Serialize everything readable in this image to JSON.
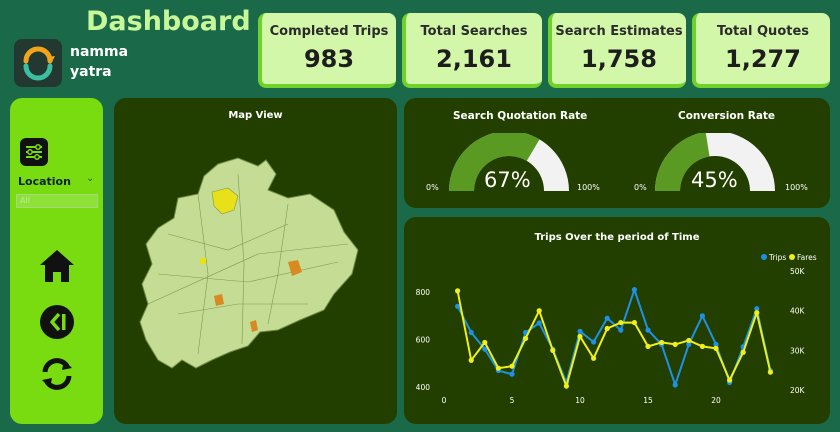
{
  "header": {
    "title": "Dashboard",
    "brand_line1": "namma",
    "brand_line2": "yatra"
  },
  "kpis": [
    {
      "label": "Completed Trips",
      "value": "983"
    },
    {
      "label": "Total Searches",
      "value": "2,161"
    },
    {
      "label": "Search Estimates",
      "value": "1,758"
    },
    {
      "label": "Total Quotes",
      "value": "1,277"
    }
  ],
  "sidebar": {
    "filter_label": "Location",
    "filter_value": "All",
    "icons": [
      "filter-icon",
      "home-icon",
      "skip-back-icon",
      "refresh-icon"
    ]
  },
  "map": {
    "title": "Map View"
  },
  "gauges": [
    {
      "title": "Search Quotation Rate",
      "value_text": "67%",
      "min_label": "0%",
      "max_label": "100%",
      "fraction": 0.67
    },
    {
      "title": "Conversion Rate",
      "value_text": "45%",
      "min_label": "0%",
      "max_label": "100%",
      "fraction": 0.45
    }
  ],
  "colors": {
    "background": "#1a6a4a",
    "panel": "#233f00",
    "kpi_card": "#d3f7a8",
    "sidebar": "#79dc10",
    "gauge_fill": "#5a9a22",
    "gauge_track": "#f2f2f2",
    "trips": "#1e90e8",
    "fares": "#f0f018",
    "map_region": "#c4dc94",
    "map_highlight_yellow": "#e8e018",
    "map_highlight_orange": "#d88a20"
  },
  "chart_data": {
    "type": "line",
    "title": "Trips Over the period of Time",
    "x": [
      1,
      2,
      3,
      4,
      5,
      6,
      7,
      8,
      9,
      10,
      11,
      12,
      13,
      14,
      15,
      16,
      17,
      18,
      19,
      20,
      21,
      22,
      23,
      24
    ],
    "x_ticks": [
      "0",
      "5",
      "10",
      "15",
      "20"
    ],
    "x_tick_values": [
      0,
      5,
      10,
      15,
      20
    ],
    "xlim": [
      0,
      25
    ],
    "y_left_ticks": [
      "400",
      "600",
      "800"
    ],
    "y_right_ticks": [
      "20K",
      "30K",
      "40K",
      "50K"
    ],
    "ylim_left": [
      380,
      880
    ],
    "ylim_right": [
      19500,
      49500
    ],
    "legend_position": "top-right",
    "series": [
      {
        "name": "Trips",
        "axis": "left",
        "values": [
          740,
          630,
          560,
          470,
          455,
          630,
          670,
          560,
          420,
          635,
          590,
          690,
          640,
          810,
          640,
          580,
          410,
          580,
          700,
          580,
          420,
          570,
          730,
          470
        ]
      },
      {
        "name": "Fares",
        "axis": "right",
        "values": [
          45000,
          27500,
          32000,
          25500,
          26000,
          33000,
          40000,
          30000,
          21000,
          33500,
          28000,
          35500,
          37000,
          37000,
          31000,
          32000,
          31500,
          32500,
          31000,
          30500,
          22500,
          29500,
          39500,
          24500
        ]
      }
    ]
  }
}
